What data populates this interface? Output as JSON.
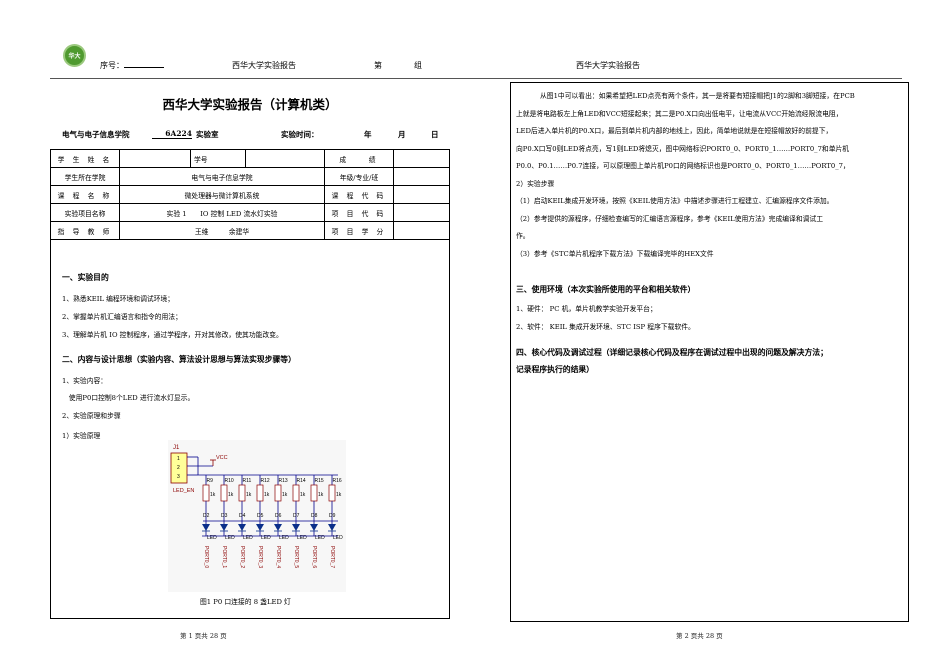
{
  "header": {
    "logo_text": "华大",
    "student_no_label": "序号：",
    "left_report": "西华大学实验报告",
    "group_prefix": "第",
    "group_suffix": "组",
    "right_report": "西华大学实验报告"
  },
  "left_page": {
    "title": "西华大学实验报告（计算机类）",
    "info_line": {
      "school": "电气与电子信息学院",
      "room": "6A224",
      "room_suffix": "实验室",
      "time_label": "实验时间：",
      "year": "年",
      "month": "月",
      "day": "日"
    },
    "info_table": [
      [
        "学 生 姓 名",
        "",
        "学号",
        "",
        "成　　绩",
        ""
      ],
      [
        "学生所在学院",
        "电气与电子信息学院",
        "年级/专业/班",
        ""
      ],
      [
        "课 程 名 称",
        "微处理器与微计算机系统",
        "课 程 代 码",
        ""
      ],
      [
        "实验项目名称",
        "实验 1　　IO 控制 LED 流水灯实验",
        "项 目 代 码",
        ""
      ],
      [
        "指 导 教 师",
        "王维　　　余建华",
        "项 目 学 分",
        ""
      ]
    ],
    "sections": {
      "s1_title": "一、实验目的",
      "s1_items": [
        "1、熟悉KEIL 编程环境和调试环境；",
        "2、掌握单片机汇编语言和指令的用法；",
        "3、理解单片机 IO 控制程序，通过学程序，开对其修改，使其功能改变。"
      ],
      "s2_title": "二、内容与设计思想（实验内容、算法设计思想与算法实现步骤等）",
      "s2_items": [
        "1、实验内容：",
        "　使用P0口控制8个LED 进行流水灯显示。",
        "2、实验原理和步骤",
        "1）实验原理"
      ],
      "figure_caption": "图1 P0 口连接的 8 盏LED 灯"
    },
    "schematic": {
      "connector": "J1",
      "pins": [
        "1",
        "2",
        "3"
      ],
      "net_label": "LED_EN",
      "vcc": "VCC",
      "resistors": [
        "R9",
        "R10",
        "R11",
        "R12",
        "R13",
        "R14",
        "R15",
        "R16"
      ],
      "resistor_value": "1k",
      "diodes": [
        "D2",
        "D3",
        "D4",
        "D5",
        "D6",
        "D7",
        "D8",
        "D9"
      ],
      "led_label": "LED",
      "ports": [
        "PORT0_0",
        "PORT0_1",
        "PORT0_2",
        "PORT0_3",
        "PORT0_4",
        "PORT0_5",
        "PORT0_6",
        "PORT0_7"
      ]
    },
    "footer": "第 1 页共 28 页"
  },
  "right_page": {
    "paragraph": [
      "从图1中可以看出：如果希望把LED点亮有两个条件，其一是将要有短接帽把J1的2脚和3脚短接，在PCB",
      "上就是将电路板左上角LED和VCC短接起来；其二是P0.X口向出低电平，让电流从VCC开始流经限流电阻，",
      "LED后进入单片机的P0.X口，最后到单片机内部的地线上，因此，简单地说就是在短接帽放好的前提下，",
      "向P0.X口写0则LED将点亮，写1则LED将熄灭，图中网络标识PORT0_0、PORT0_1……PORT0_7和单片机",
      "P0.0、P0.1……P0.7连接，可以原理图上单片机P0口的网络标识也是PORT0_0、PORT0_1……PORT0_7，"
    ],
    "steps_title": "2）实验步骤",
    "steps": [
      "（1）启动KEIL集成开发环境，按照《KEIL使用方法》中描述步骤进行工程建立、汇编源程序文件添加。",
      "（2）参考提供的源程序，仔细检查编写的汇编语言源程序，参考《KEIL使用方法》完成编译和调试工",
      "作。",
      "（3）参考《STC单片机程序下载方法》下载编译完毕的HEX文件"
    ],
    "s3_title": "三、使用环境（本次实验所使用的平台和相关软件）",
    "s3_items": [
      "1、硬件： PC 机，单片机教学实验开发平台；",
      "2、软件： KEIL 集成开发环境、STC ISP 程序下载软件。"
    ],
    "s4_title_line1": "四、核心代码及调试过程（详细记录核心代码及程序在调试过程中出现的问题及解决方法；",
    "s4_title_line2": "记录程序执行的结果）",
    "footer": "第 2 页共 28 页"
  }
}
